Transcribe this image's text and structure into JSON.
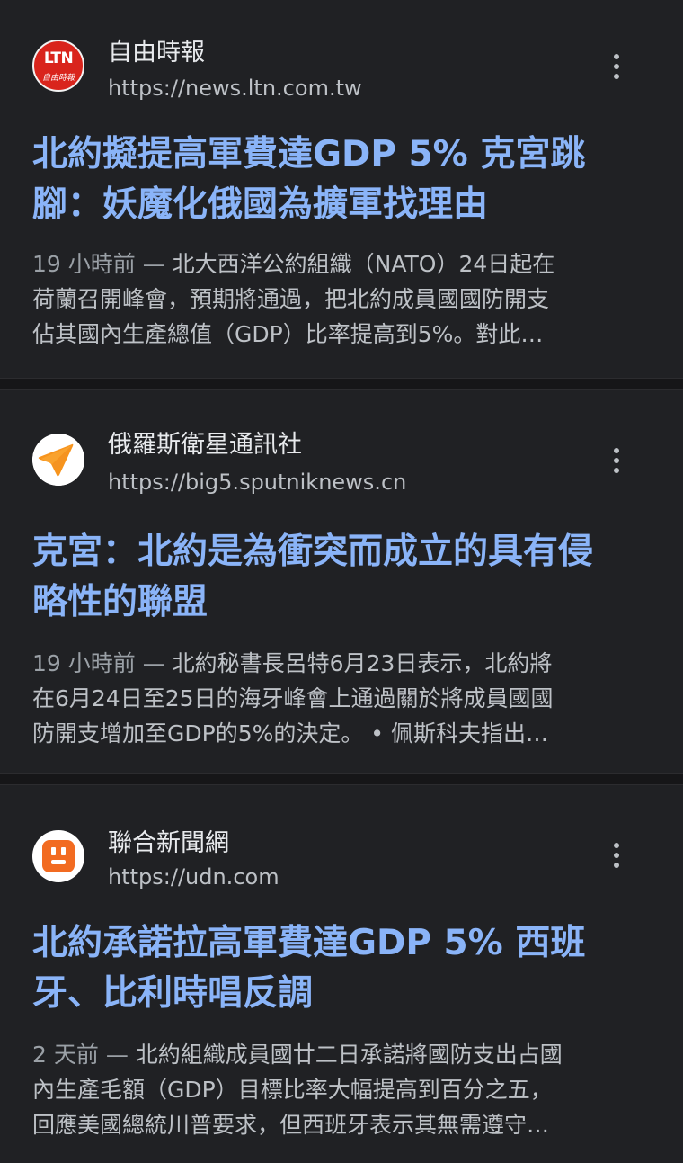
{
  "articles": [
    {
      "source_name": "自由時報",
      "source_url": "https://news.ltn.com.tw",
      "logo_icon": "ltn-logo-icon",
      "logo_text": "LTN",
      "logo_subtext": "自由時報",
      "headline": [
        "北約擬提高軍費達GDP 5% 克宮跳",
        "腳：妖魔化俄國為擴軍找理由"
      ],
      "time": "19 小時前",
      "separator": "—",
      "snippet_lines": [
        "北大西洋公約組織（NATO）24日起在",
        "荷蘭召開峰會，預期將通過，把北約成員國國防開支",
        "佔其國內生產總值（GDP）比率提高到5%。對此…"
      ]
    },
    {
      "source_name": "俄羅斯衛星通訊社",
      "source_url": "https://big5.sputniknews.cn",
      "logo_icon": "sputnik-logo-icon",
      "headline": [
        "克宮：北約是為衝突而成立的具有侵",
        "略性的聯盟"
      ],
      "time": "19 小時前",
      "separator": "—",
      "snippet_lines": [
        "北約秘書長呂特6月23日表示，北約將",
        "在6月24日至25日的海牙峰會上通過關於將成員國國",
        "防開支增加至GDP的5%的決定。 • 佩斯科夫指出…"
      ]
    },
    {
      "source_name": "聯合新聞網",
      "source_url": "https://udn.com",
      "logo_icon": "udn-logo-icon",
      "headline": [
        "北約承諾拉高軍費達GDP 5% 西班",
        "牙、比利時唱反調"
      ],
      "time": "2 天前",
      "separator": "—",
      "snippet_lines": [
        "北約組織成員國廿二日承諾將國防支出占國",
        "內生產毛額（GDP）目標比率大幅提高到百分之五，",
        "回應美國總統川普要求，但西班牙表示其無需遵守…"
      ]
    }
  ],
  "more_button_icon": "more-vert-icon",
  "colors": {
    "background": "#202124",
    "headline": "#8ab4f8",
    "text_primary": "#e8eaed",
    "text_secondary": "#bdc1c6",
    "ltn_red": "#d9241c",
    "sputnik_orange": "#f7941d",
    "udn_orange": "#f26b21"
  }
}
